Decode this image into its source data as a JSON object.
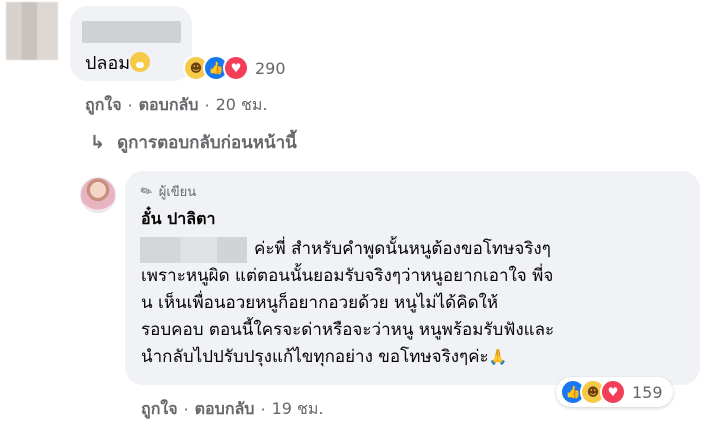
{
  "comment1": {
    "text": "ปลอม",
    "emoji_icon": "crying-face",
    "reactions": [
      "haha",
      "like",
      "love"
    ],
    "reaction_count": "290",
    "actions": {
      "like": "ถูกใจ",
      "reply": "ตอบกลับ",
      "time": "20 ชม."
    }
  },
  "view_previous": "ดูการตอบกลับก่อนหน้านี้",
  "comment2": {
    "author_badge": "ผู้เขียน",
    "author_name": "อั๋น ปาลิตา",
    "lines": [
      "ค่ะพี่ สำหรับคำพูดนั้นหนูต้องขอโทษจริงๆ",
      "เพราะหนูผิด แต่ตอนนั้นยอมรับจริงๆว่าหนูอยากเอาใจ พี่จ",
      "น เห็นเพื่อนอวยหนูก็อยากอวยด้วย หนูไม่ได้คิดให้",
      "รอบคอบ ตอนนี้ใครจะด่าหรือจะว่าหนู หนูพร้อมรับฟังและ",
      "นำกลับไปปรับปรุงแก้ไขทุกอย่าง ขอโทษจริงๆค่ะ"
    ],
    "end_emoji": "🙏",
    "reactions": [
      "like",
      "haha",
      "love"
    ],
    "reaction_count": "159",
    "actions": {
      "like": "ถูกใจ",
      "reply": "ตอบกลับ",
      "time": "19 ชม."
    }
  },
  "colors": {
    "bubble": "#f0f2f5",
    "meta": "#65676b",
    "text": "#050505"
  }
}
